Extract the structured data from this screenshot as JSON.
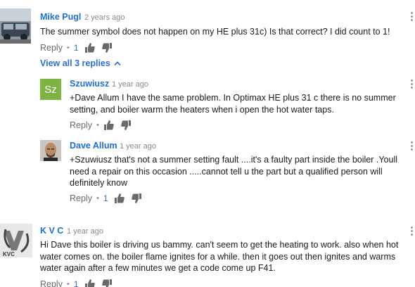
{
  "comments": [
    {
      "author": "Mike Pugl",
      "time": "2 years ago",
      "text": "The summer symbol does not happen on my HE plus 31c) Is that correct? I did count to 1!",
      "reply_label": "Reply",
      "likes": "1"
    }
  ],
  "view_replies_label": "View all 3 replies",
  "replies": [
    {
      "author": "Szuwiusz",
      "avatar_initials": "Sz",
      "avatar_color": "#7cb342",
      "time": "1 year ago",
      "text": "+Dave Allum I have the same problem. In Optimax HE plus 31 c there is no summer setting, and boiler warm the heaters when i open the hot water taps.",
      "reply_label": "Reply"
    },
    {
      "author": "Dave Allum",
      "time": "1 year ago",
      "text": "+Szuwiusz that's not a summer setting fault ....it's a faulty part inside the boiler .Youll need a repair on this occasion .....cannot tell u the part but a qualified person will definitely know",
      "reply_label": "Reply",
      "likes": "1"
    }
  ],
  "second_comment": {
    "author": "K V C",
    "time": "1 year ago",
    "text": "Hi  Dave this boiler is driving us bammy.  can't seem to get the heating to work. also when hot water comes on. the boiler flame ignites for a while. then it goes out then ignites and warms water again  after a few minutes we get a code come up F41.",
    "reply_label": "Reply",
    "likes": "1",
    "avatar_letters": "KVC"
  },
  "colors": {
    "author_link": "#1f6fd0",
    "likes": "#3a70c8"
  }
}
